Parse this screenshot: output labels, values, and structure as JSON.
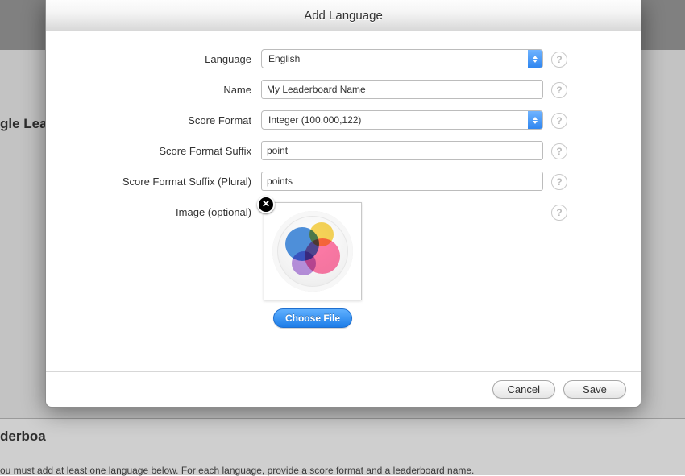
{
  "background": {
    "page_title_fragment": "gle Lead",
    "section_title_fragment": "derboa",
    "hint_fragment": "ou must add at least one language below. For each language, provide a score format and a leaderboard name."
  },
  "dialog": {
    "title": "Add Language",
    "fields": {
      "language": {
        "label": "Language",
        "value": "English"
      },
      "name": {
        "label": "Name",
        "value": "My Leaderboard Name"
      },
      "score_format": {
        "label": "Score Format",
        "value": "Integer (100,000,122)"
      },
      "suffix": {
        "label": "Score Format Suffix",
        "value": "point"
      },
      "suffix_plural": {
        "label": "Score Format Suffix (Plural)",
        "value": "points"
      },
      "image": {
        "label": "Image (optional)",
        "choose_file": "Choose File"
      }
    },
    "buttons": {
      "cancel": "Cancel",
      "save": "Save"
    },
    "help_glyph": "?"
  }
}
